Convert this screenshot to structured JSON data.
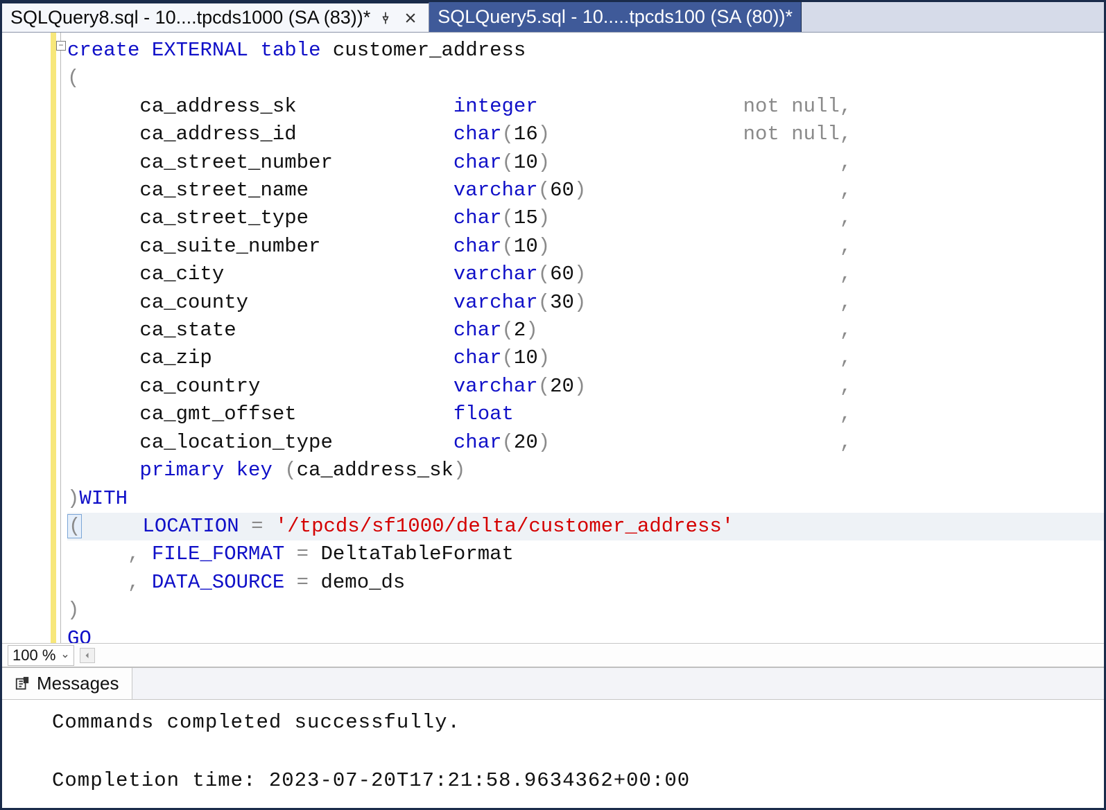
{
  "tabs": {
    "active": {
      "label": "SQLQuery8.sql - 10....tpcds1000 (SA (83))*"
    },
    "inactive": {
      "label": "SQLQuery5.sql - 10.....tpcds100 (SA (80))*"
    }
  },
  "fold_glyph": "−",
  "zoom": {
    "value": "100 %"
  },
  "code": {
    "l1": {
      "k1": "create",
      "k2": "EXTERNAL",
      "k3": "table",
      "ident": "customer_address"
    },
    "l2": "(",
    "cols": [
      {
        "name": "ca_address_sk",
        "type": "integer",
        "constraint": "not null",
        "comma": ","
      },
      {
        "name": "ca_address_id",
        "type": "char",
        "len": "16",
        "constraint": "not null",
        "comma": ","
      },
      {
        "name": "ca_street_number",
        "type": "char",
        "len": "10",
        "constraint": "",
        "comma": ","
      },
      {
        "name": "ca_street_name",
        "type": "varchar",
        "len": "60",
        "constraint": "",
        "comma": ","
      },
      {
        "name": "ca_street_type",
        "type": "char",
        "len": "15",
        "constraint": "",
        "comma": ","
      },
      {
        "name": "ca_suite_number",
        "type": "char",
        "len": "10",
        "constraint": "",
        "comma": ","
      },
      {
        "name": "ca_city",
        "type": "varchar",
        "len": "60",
        "constraint": "",
        "comma": ","
      },
      {
        "name": "ca_county",
        "type": "varchar",
        "len": "30",
        "constraint": "",
        "comma": ","
      },
      {
        "name": "ca_state",
        "type": "char",
        "len": "2",
        "constraint": "",
        "comma": ","
      },
      {
        "name": "ca_zip",
        "type": "char",
        "len": "10",
        "constraint": "",
        "comma": ","
      },
      {
        "name": "ca_country",
        "type": "varchar",
        "len": "20",
        "constraint": "",
        "comma": ","
      },
      {
        "name": "ca_gmt_offset",
        "type": "float",
        "constraint": "",
        "comma": ","
      },
      {
        "name": "ca_location_type",
        "type": "char",
        "len": "20",
        "constraint": "",
        "comma": ","
      }
    ],
    "pk": {
      "k1": "primary",
      "k2": "key",
      "col": "ca_address_sk"
    },
    "with": {
      "close": ")",
      "kw": "WITH"
    },
    "loc": {
      "kw": "LOCATION",
      "eq": "=",
      "val": "'/tpcds/sf1000/delta/customer_address'"
    },
    "ff": {
      "kw": "FILE_FORMAT",
      "eq": "=",
      "val": "DeltaTableFormat"
    },
    "ds": {
      "kw": "DATA_SOURCE",
      "eq": "=",
      "val": "demo_ds"
    },
    "close2": ")",
    "go": "GO"
  },
  "messages": {
    "tab_label": "Messages",
    "line1": "Commands completed successfully.",
    "line2": "Completion time: 2023-07-20T17:21:58.9634362+00:00"
  }
}
